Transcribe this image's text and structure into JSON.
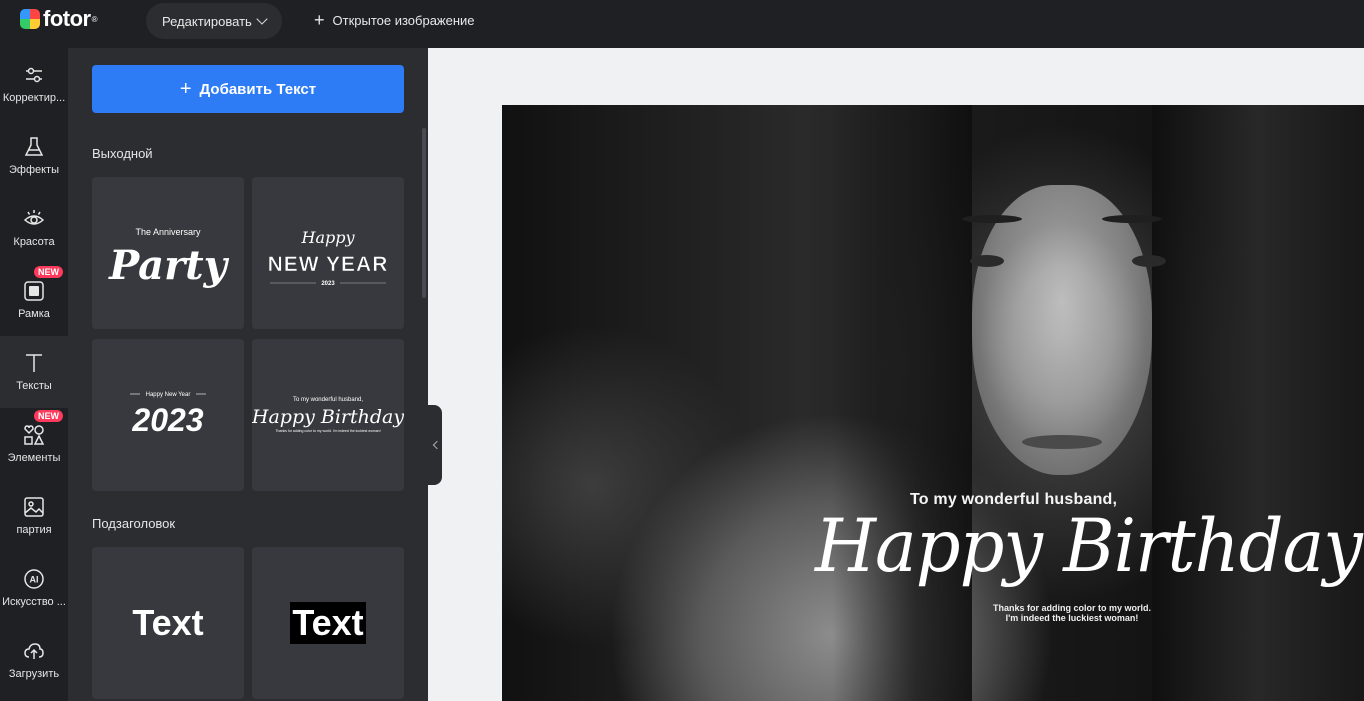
{
  "header": {
    "logo_text": "fotor",
    "logo_sup": "®",
    "edit_label": "Редактировать",
    "open_image_label": "Открытое изображение"
  },
  "rail": {
    "items": [
      {
        "label": "Корректир...",
        "icon": "sliders-icon"
      },
      {
        "label": "Эффекты",
        "icon": "flask-icon"
      },
      {
        "label": "Красота",
        "icon": "eye-icon"
      },
      {
        "label": "Рамка",
        "icon": "frame-icon",
        "badge": "NEW"
      },
      {
        "label": "Тексты",
        "icon": "text-icon",
        "active": true
      },
      {
        "label": "Элементы",
        "icon": "shapes-icon",
        "badge": "NEW"
      },
      {
        "label": "партия",
        "icon": "batch-image-icon"
      },
      {
        "label": "Искусство ...",
        "icon": "ai-icon"
      },
      {
        "label": "Загрузить",
        "icon": "upload-cloud-icon"
      }
    ]
  },
  "panel": {
    "add_text_label": "Добавить Текст",
    "sections": [
      {
        "title": "Выходной"
      },
      {
        "title": "Подзаголовок"
      }
    ],
    "tiles": {
      "party": {
        "small": "The Anniversary",
        "big": "Party"
      },
      "newyear": {
        "script": "Happy",
        "big": "NEW YEAR",
        "year": "2023"
      },
      "y2023": {
        "small": "Happy New Year",
        "big": "2023"
      },
      "birthday": {
        "small": "To my wonderful husband,",
        "big": "Happy Birthday",
        "tiny": "Thanks for adding color to my world. I'm indeed the luckiest woman!"
      },
      "text1": {
        "label": "Text"
      },
      "text2": {
        "label": "Text"
      }
    }
  },
  "canvas": {
    "line1": "To my wonderful husband,",
    "line2": "Happy Birthday",
    "line3a": "Thanks for adding color to my world.",
    "line3b": "I'm indeed the luckiest woman!"
  },
  "colors": {
    "accent": "#2d7cf6",
    "badge": "#ff3a5c",
    "panel_bg": "#2c2d31",
    "app_bg": "#1f2023"
  }
}
